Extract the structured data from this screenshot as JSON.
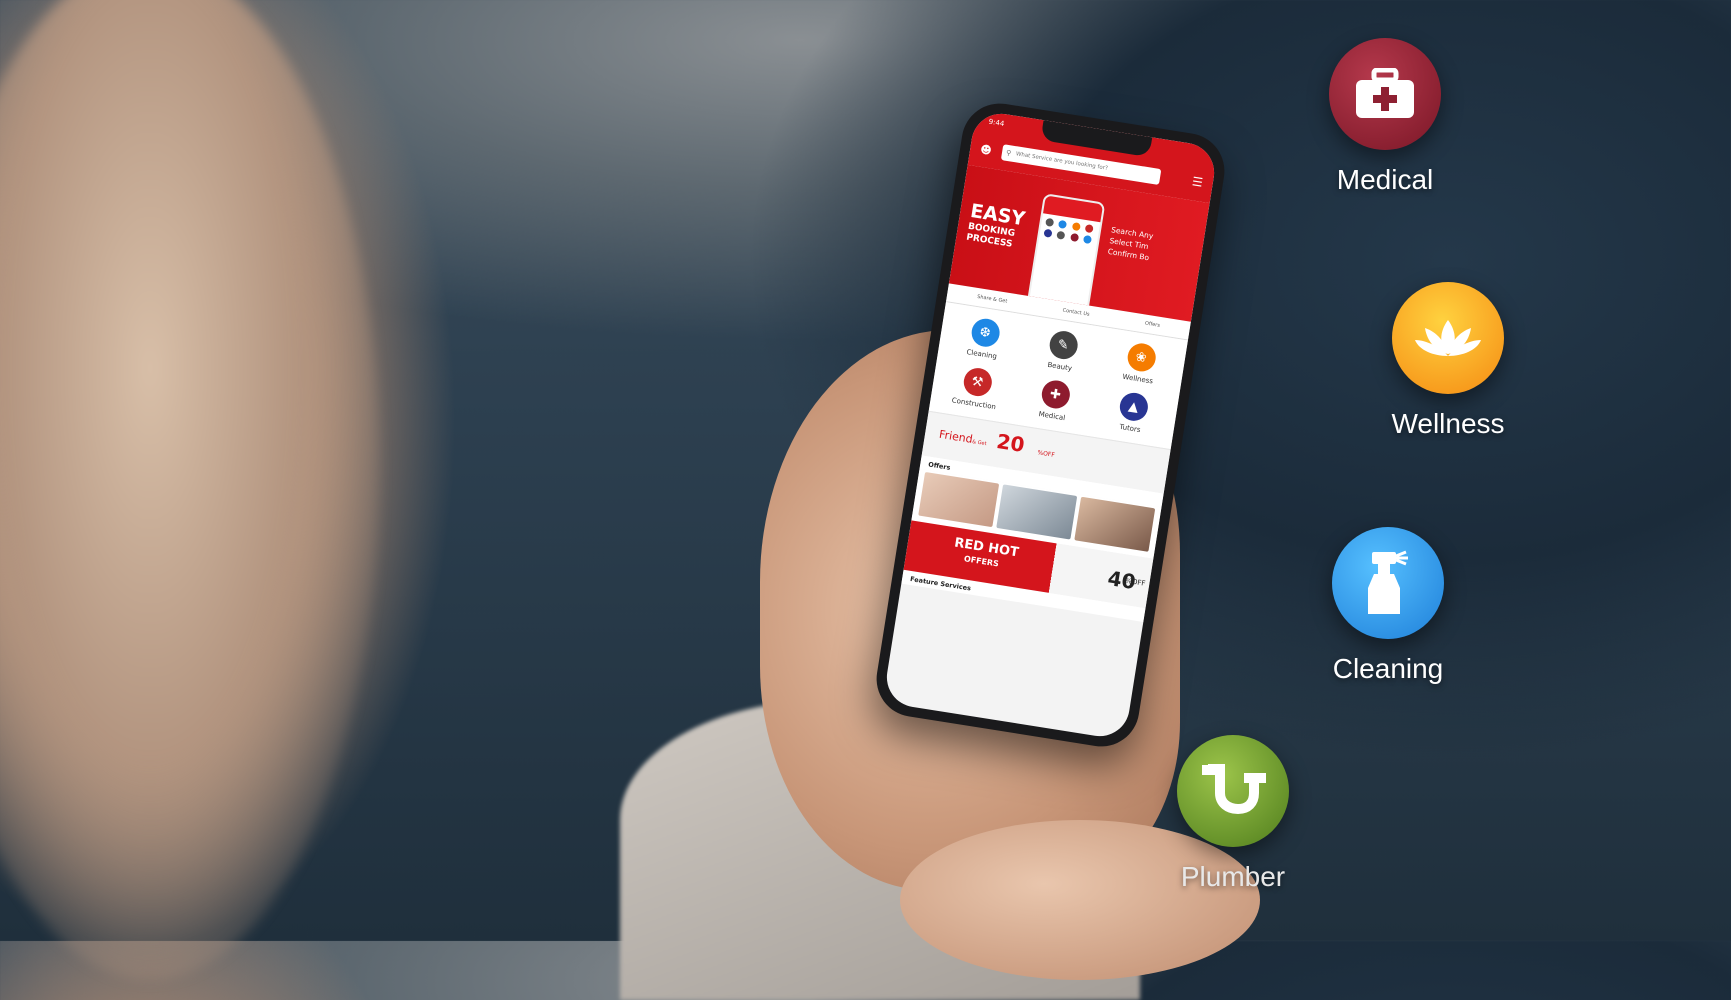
{
  "app": {
    "status_time": "9:44",
    "search_placeholder": "What Service are you looking for?",
    "banner": {
      "headline": "EASY",
      "sub_line1": "BOOKING",
      "sub_line2": "PROCESS",
      "steps_line1": "Search Any",
      "steps_line2": "Select Tim",
      "steps_line3": "Confirm Bo"
    },
    "actions": [
      {
        "label": "Share & Get"
      },
      {
        "label": "Contact Us"
      },
      {
        "label": "Offers"
      }
    ],
    "categories": [
      {
        "label": "Cleaning",
        "color": "#1e88e5",
        "icon": "spray-bottle-icon"
      },
      {
        "label": "Beauty",
        "color": "#424242",
        "icon": "brush-icon"
      },
      {
        "label": "Wellness",
        "color": "#f57c00",
        "icon": "lotus-icon"
      },
      {
        "label": "Construction",
        "color": "#c62828",
        "icon": "worker-icon"
      },
      {
        "label": "Medical",
        "color": "#8e1b2e",
        "icon": "first-aid-icon"
      },
      {
        "label": "Tutors",
        "color": "#283593",
        "icon": "graduation-cap-icon"
      }
    ],
    "promo_friend": {
      "text": "Friend",
      "small": "& Get",
      "percent": "20",
      "off": "%OFF"
    },
    "offers_title": "Offers",
    "promo_hot": {
      "line1": "RED HOT",
      "line2": "OFFERS",
      "percent": "40",
      "off": "%OFF"
    },
    "feature_title": "Feature Services"
  },
  "floating": [
    {
      "label": "Medical",
      "icon": "first-aid-kit-icon",
      "color": "#8e2032"
    },
    {
      "label": "Wellness",
      "icon": "lotus-icon",
      "color": "#f59a1a"
    },
    {
      "label": "Cleaning",
      "icon": "spray-bottle-icon",
      "color": "#2a9be8"
    },
    {
      "label": "Plumber",
      "icon": "pipe-icon",
      "color": "#6f9a2a"
    }
  ]
}
